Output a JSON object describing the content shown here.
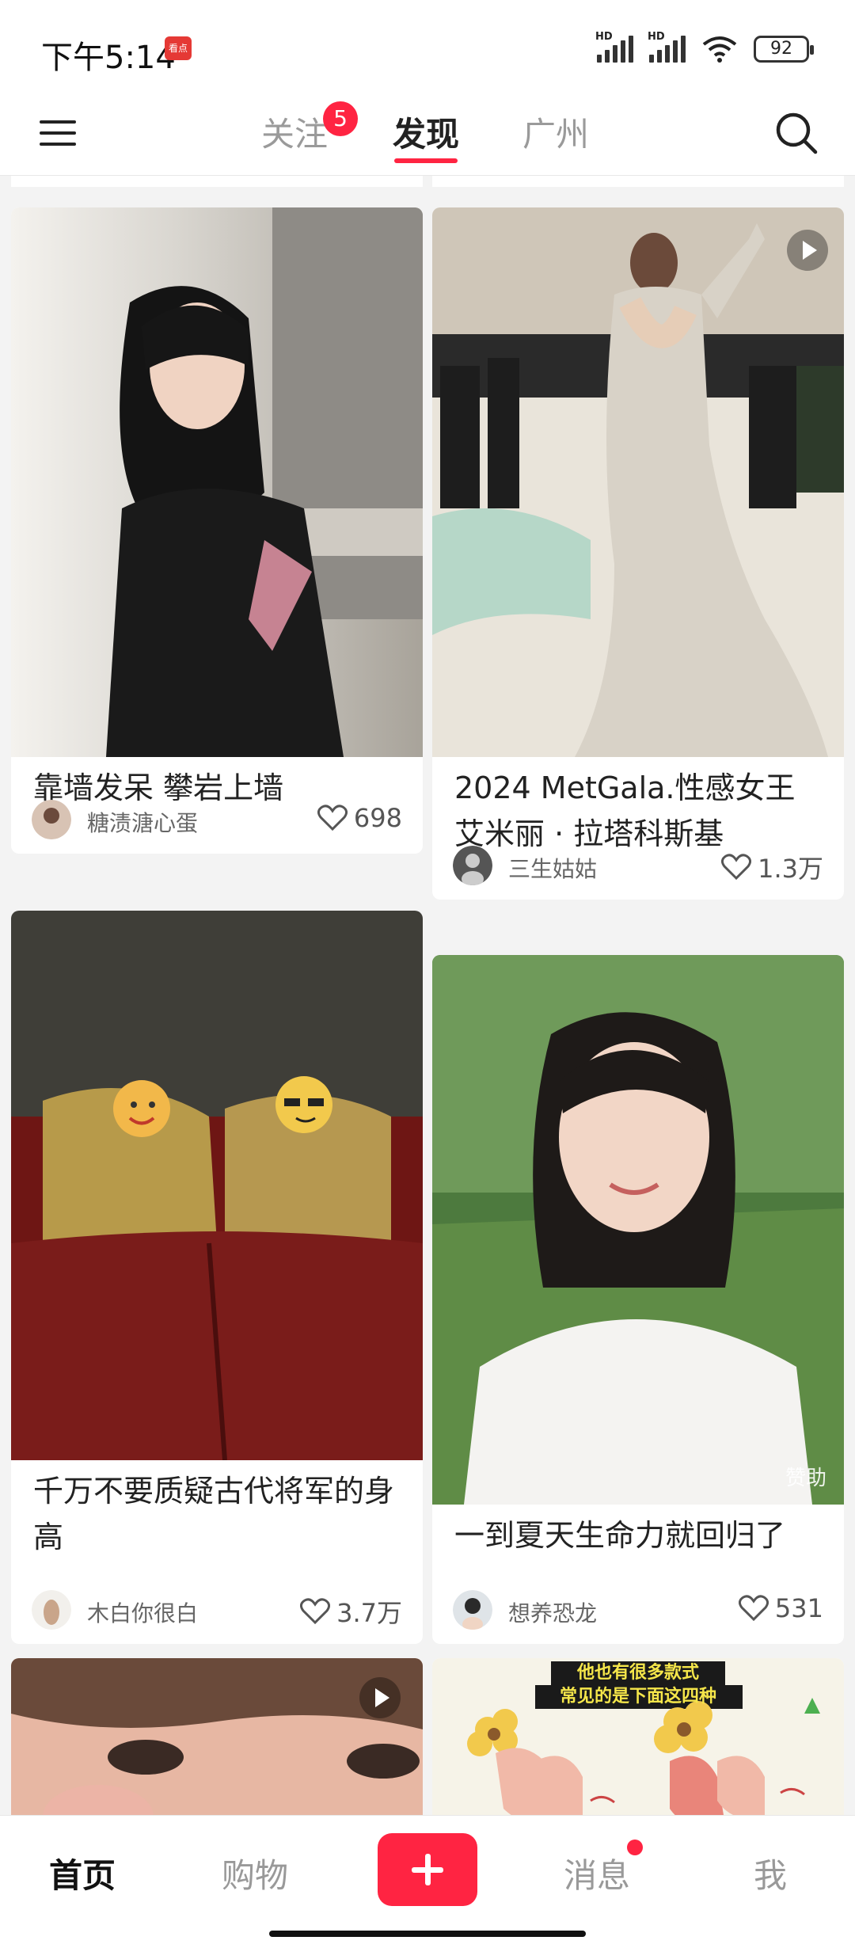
{
  "status_bar": {
    "time": "下午5:14",
    "app_badge": "看点",
    "hd1": "HD",
    "hd2": "HD",
    "battery": "92"
  },
  "top_nav": {
    "tabs": [
      {
        "label": "关注"
      },
      {
        "label": "发现"
      },
      {
        "label": "广州"
      }
    ],
    "follow_badge": "5",
    "active_tab": "发现"
  },
  "feed": {
    "cards": [
      {
        "title": "靠墙发呆 攀岩上墙",
        "author": "糖渍溏心蛋",
        "likes": "698",
        "video": false
      },
      {
        "title": "2024 MetGala.性感女王艾米丽 · 拉塔科斯基",
        "author": "三生姑姑",
        "likes": "1.3万",
        "video": true
      },
      {
        "title": "千万不要质疑古代将军的身高",
        "author": "木白你很白",
        "likes": "3.7万",
        "video": false
      },
      {
        "title": "一到夏天生命力就回归了",
        "author": "想养恐龙",
        "likes": "531",
        "video": false,
        "sponsor": "赞助"
      },
      {
        "title": "",
        "author": "",
        "likes": "",
        "video": true
      },
      {
        "title": "",
        "author": "",
        "likes": "",
        "video": false,
        "caption_line1": "他也有很多款式",
        "caption_line2": "常见的是下面这四种"
      }
    ]
  },
  "bottom_nav": {
    "items": [
      {
        "label": "首页"
      },
      {
        "label": "购物"
      },
      {
        "label": "消息"
      },
      {
        "label": "我"
      }
    ],
    "active": "首页"
  },
  "colors": {
    "accent": "#ff2442",
    "text": "#222222",
    "muted": "#999999"
  }
}
